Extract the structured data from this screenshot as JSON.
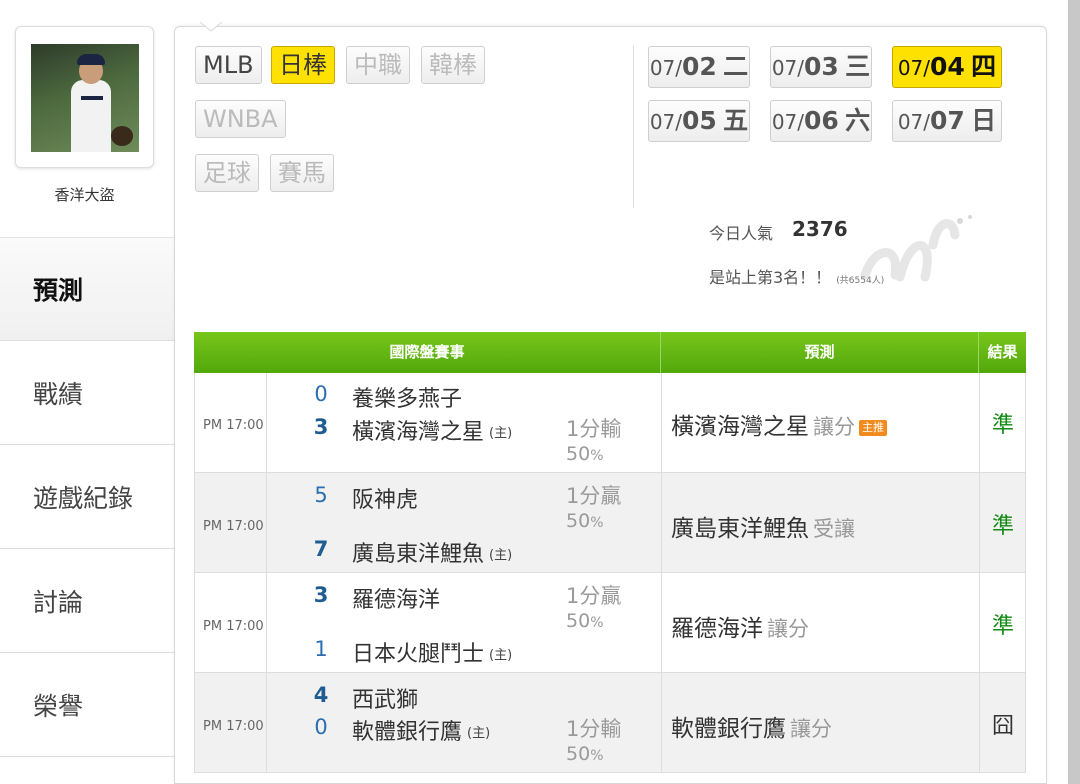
{
  "user": {
    "name": "香洋大盜"
  },
  "nav": [
    {
      "label": "預測",
      "active": true
    },
    {
      "label": "戰績",
      "active": false
    },
    {
      "label": "遊戲紀錄",
      "active": false
    },
    {
      "label": "討論",
      "active": false
    },
    {
      "label": "榮譽",
      "active": false
    }
  ],
  "sports": [
    {
      "label": "MLB",
      "state": "enabled"
    },
    {
      "label": "日棒",
      "state": "active"
    },
    {
      "label": "中職",
      "state": "disabled"
    },
    {
      "label": "韓棒",
      "state": "disabled"
    },
    {
      "label": "WNBA",
      "state": "disabled"
    },
    {
      "label": "足球",
      "state": "disabled"
    },
    {
      "label": "賽馬",
      "state": "disabled"
    }
  ],
  "dates": [
    {
      "month": "07/",
      "day": "02",
      "weekday": "二",
      "active": false
    },
    {
      "month": "07/",
      "day": "03",
      "weekday": "三",
      "active": false
    },
    {
      "month": "07/",
      "day": "04",
      "weekday": "四",
      "active": true
    },
    {
      "month": "07/",
      "day": "05",
      "weekday": "五",
      "active": false
    },
    {
      "month": "07/",
      "day": "06",
      "weekday": "六",
      "active": false
    },
    {
      "month": "07/",
      "day": "07",
      "weekday": "日",
      "active": false
    }
  ],
  "popularity": {
    "label": "今日人氣",
    "value": "2376",
    "rank_text": "是站上第3名！！",
    "rank_total": "(共6554人)"
  },
  "table": {
    "headers": {
      "match": "國際盤賽事",
      "prediction": "預測",
      "result": "結果"
    },
    "home_tag": "(主)",
    "main_tag": "主推",
    "rows": [
      {
        "time": "PM 17:00",
        "away": {
          "score": "0",
          "name": "養樂多燕子"
        },
        "home": {
          "score": "3",
          "name": "橫濱海灣之星"
        },
        "line": "1分輸",
        "pct": "50",
        "pct_unit": "%",
        "pred_team": "橫濱海灣之星",
        "pred_type": "讓分",
        "main": true,
        "result": "準"
      },
      {
        "time": "PM 17:00",
        "away": {
          "score": "5",
          "name": "阪神虎"
        },
        "home": {
          "score": "7",
          "name": "廣島東洋鯉魚"
        },
        "line": "1分贏",
        "pct": "50",
        "pct_unit": "%",
        "pred_team": "廣島東洋鯉魚",
        "pred_type": "受讓",
        "main": false,
        "result": "準"
      },
      {
        "time": "PM 17:00",
        "away": {
          "score": "3",
          "name": "羅德海洋"
        },
        "home": {
          "score": "1",
          "name": "日本火腿鬥士"
        },
        "line": "1分贏",
        "pct": "50",
        "pct_unit": "%",
        "pred_team": "羅德海洋",
        "pred_type": "讓分",
        "main": false,
        "result": "準"
      },
      {
        "time": "PM 17:00",
        "away": {
          "score": "4",
          "name": "西武獅"
        },
        "home": {
          "score": "0",
          "name": "軟體銀行鷹"
        },
        "line": "1分輸",
        "pct": "50",
        "pct_unit": "%",
        "pred_team": "軟體銀行鷹",
        "pred_type": "讓分",
        "main": false,
        "result": "囧"
      }
    ]
  },
  "colors": {
    "accent_yellow": "#ffe100",
    "header_green": "#5fb313",
    "win_green": "#138a13"
  }
}
